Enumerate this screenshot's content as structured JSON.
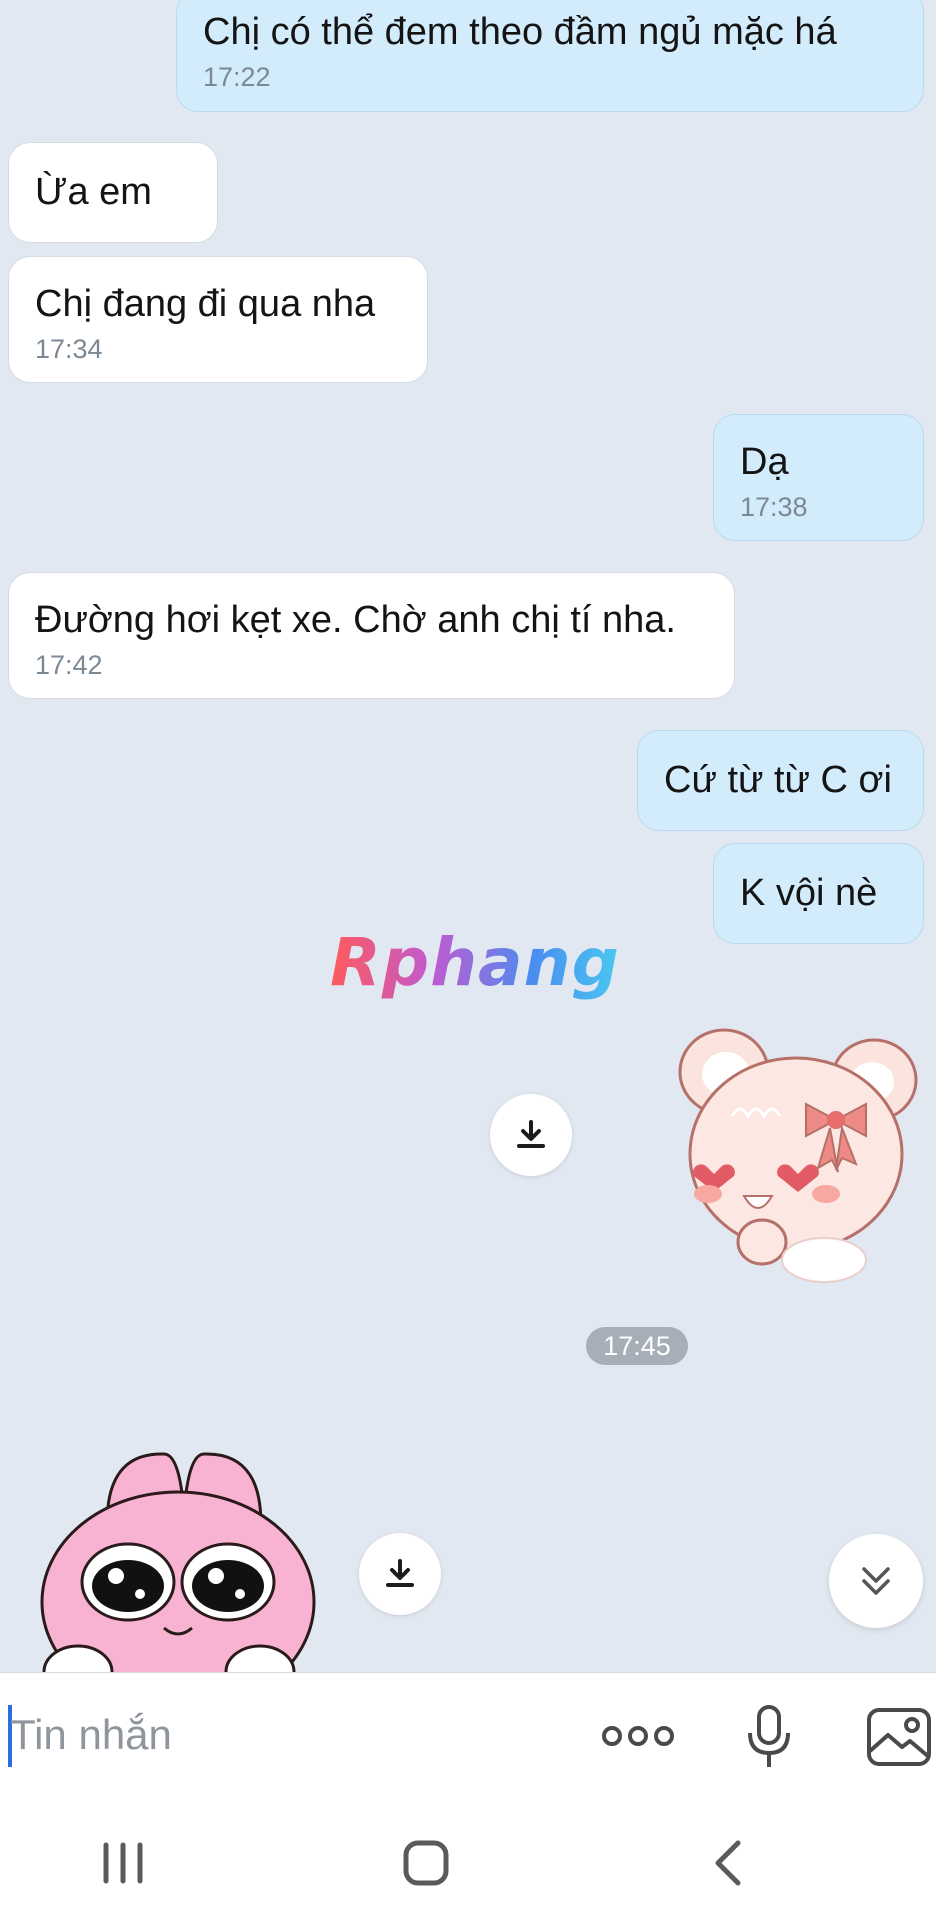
{
  "messages": [
    {
      "text": "Chị có thể đem theo đầm ngủ mặc há",
      "time": "17:22"
    },
    {
      "text": "Ừa em"
    },
    {
      "text": "Chị đang đi qua nha",
      "time": "17:34"
    },
    {
      "text": "Dạ",
      "time": "17:38"
    },
    {
      "text": "Đường hơi kẹt xe. Chờ anh chị tí nha.",
      "time": "17:42"
    },
    {
      "text": "Cứ từ từ C ơi"
    },
    {
      "text": "K vội nè"
    }
  ],
  "watermark": "Rphang",
  "time_divider": "17:45",
  "composer": {
    "placeholder": "Tin nhắn"
  },
  "icons": {
    "download": "download-icon",
    "scroll_down": "double-chevron-down-icon",
    "more": "more-dots-icon",
    "mic": "microphone-icon",
    "image": "image-icon",
    "nav_recent": "recent-apps-icon",
    "nav_home": "home-icon",
    "nav_back": "back-icon"
  },
  "colors": {
    "background": "#e2e8f1",
    "outgoing_bubble": "#d3ecfc",
    "incoming_bubble": "#ffffff",
    "caret": "#2b6fe0"
  }
}
